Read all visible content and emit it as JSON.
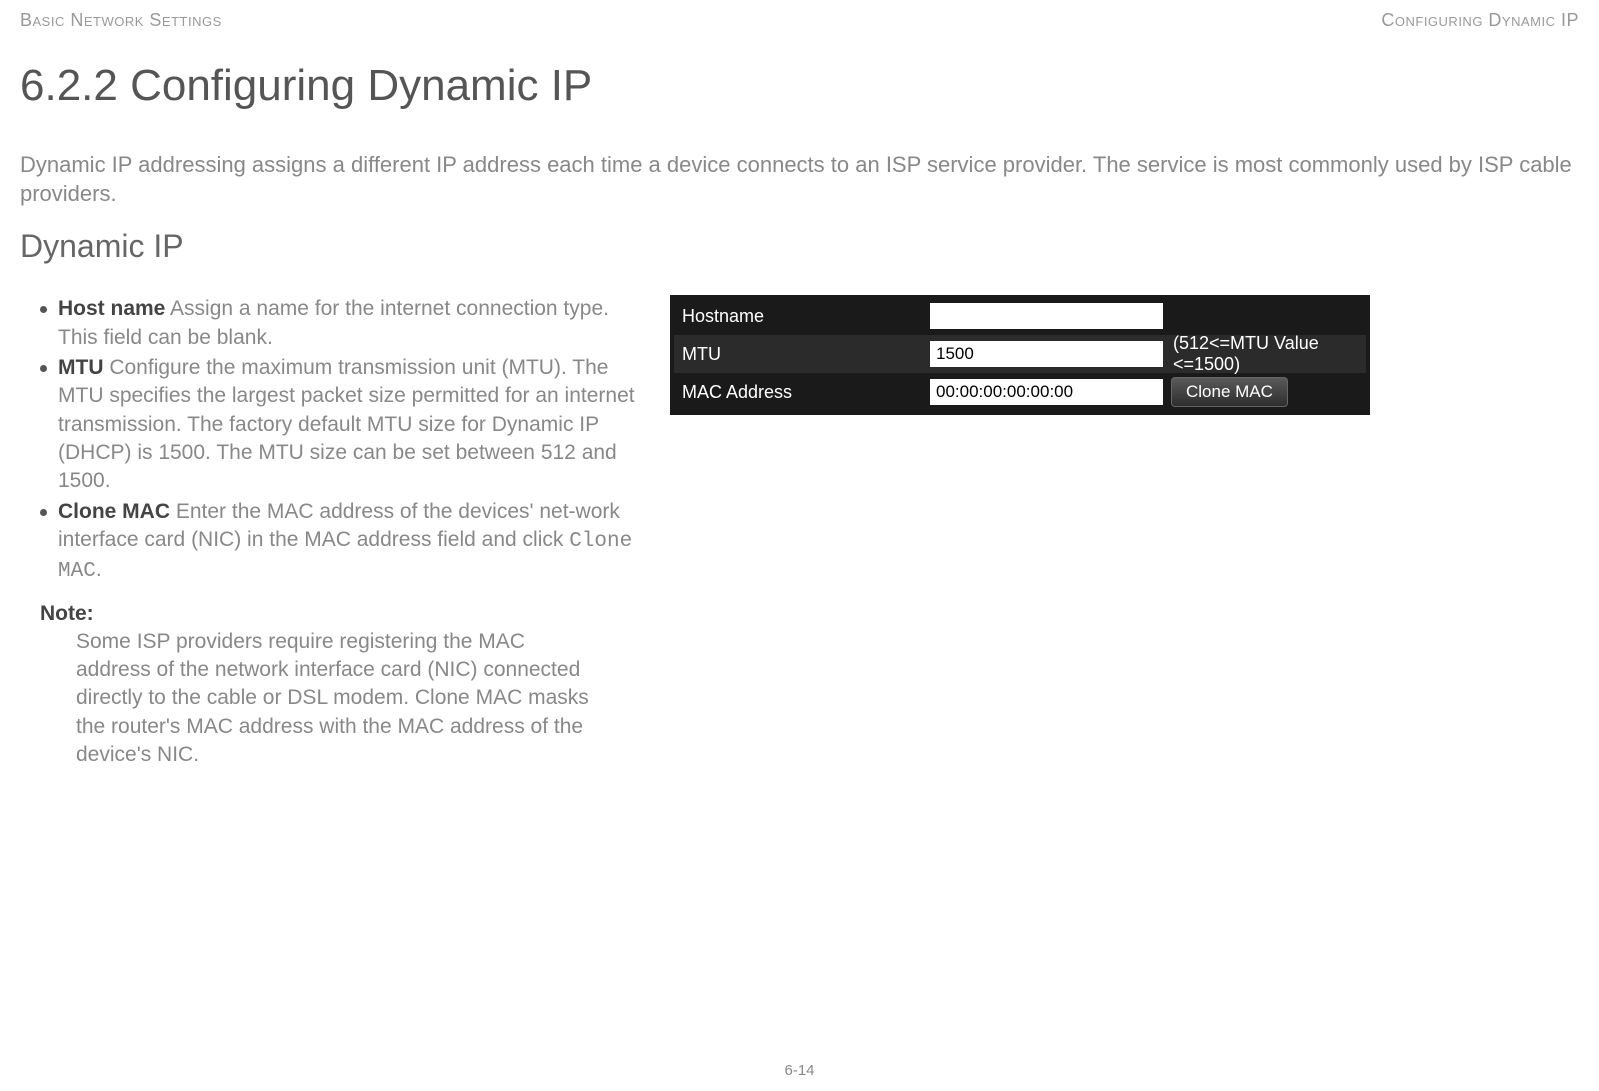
{
  "header": {
    "left": "Basic Network Settings",
    "right": "Configuring Dynamic IP"
  },
  "title": "6.2.2 Configuring Dynamic IP",
  "intro": "Dynamic IP addressing assigns a different IP address each time a device connects to an ISP service provider. The service is most commonly used by ISP cable providers.",
  "subheading": "Dynamic IP",
  "bullets": {
    "hostname_label": "Host name",
    "hostname_text": "  Assign a name for the internet connection type. This field can be blank.",
    "mtu_label": "MTU",
    "mtu_text": "  Configure the maximum transmission unit (MTU). The MTU specifies the largest packet size permitted for an internet transmission. The factory default MTU size for Dynamic IP (DHCP) is 1500. The MTU size can be set between 512 and 1500.",
    "clonemac_label": "Clone MAC",
    "clonemac_text_a": "  Enter the MAC address of the devices' net-work interface card (NIC) in the MAC address field and click ",
    "clonemac_code": "Clone MAC",
    "clonemac_text_b": "."
  },
  "note": {
    "label": "Note:",
    "text": "Some ISP providers require registering the MAC address of the network interface card (NIC) connected directly to the cable or DSL modem. Clone MAC masks the router's MAC address with the MAC address of the device's NIC."
  },
  "page_number": "6-14",
  "ui": {
    "rows": {
      "hostname": {
        "label": "Hostname",
        "value": ""
      },
      "mtu": {
        "label": "MTU",
        "value": "1500",
        "hint": "(512<=MTU Value <=1500)"
      },
      "mac": {
        "label": "MAC Address",
        "value": "00:00:00:00:00:00",
        "button": "Clone MAC"
      }
    }
  }
}
